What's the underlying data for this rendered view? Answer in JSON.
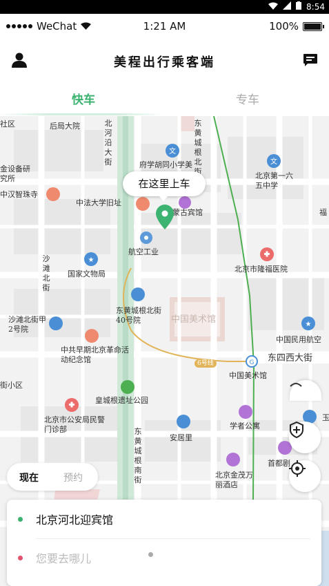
{
  "android_status": {
    "time": "8:54"
  },
  "ios_status": {
    "carrier": "WeChat",
    "time": "1:21 AM",
    "battery": "100%"
  },
  "header": {
    "title": "美程出行乘客端",
    "user_icon": "user-icon",
    "message_icon": "message-icon"
  },
  "tabs": [
    {
      "label": "快车",
      "active": true
    },
    {
      "label": "专车",
      "active": false
    }
  ],
  "colors": {
    "accent": "#3cb371",
    "route": "#e2b45a",
    "rail": "#4caf50"
  },
  "map": {
    "callout": "在这里上车",
    "labels": {
      "l1": "社区",
      "l2": "后局大院",
      "l3": "北河沿大街",
      "l4": "东黄城根北街",
      "l5": "府学胡同小学美",
      "l6": "北京第一六五中学",
      "l7": "金设备研究所",
      "l8": "中汉智珠寺",
      "l9": "中法大学旧址",
      "l10": "蒙古宾馆",
      "l11": "航空工业",
      "l12": "沙滩北街",
      "l13": "国家文物局",
      "l14": "北京市隆福医院",
      "l15": "东黄城根北街40号院",
      "l16": "中国美术馆",
      "l17": "沙滩北街甲2号院",
      "l18": "中共早期北京革命活动纪念馆",
      "l19": "中国民用航空",
      "l20": "东四西大街",
      "l21": "6号线",
      "l22": "中国美术馆",
      "l23": "街小区",
      "l24": "皇城根遗址公园",
      "l25": "北京市公安局民警门诊部",
      "l26": "东黄城根南街",
      "l27": "安居里",
      "l28": "学者公寓",
      "l29": "首都剧",
      "l30": "北京金茂万丽酒店",
      "l31": "福",
      "l32": "玉"
    }
  },
  "booking": {
    "now": "现在",
    "reserve": "预约"
  },
  "trip": {
    "pickup": "北京河北迎宾馆",
    "destination_placeholder": "您要去哪儿"
  }
}
